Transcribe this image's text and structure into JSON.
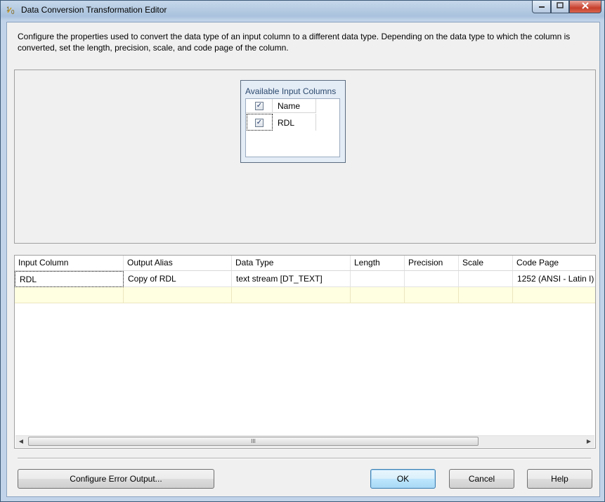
{
  "window": {
    "title": "Data Conversion Transformation Editor",
    "icon": "data-conversion-icon",
    "controls": {
      "minimize": "minimize-icon",
      "maximize": "maximize-icon",
      "close": "close-icon"
    }
  },
  "instructions": "Configure the properties used to convert the data type of an input column to a different data type. Depending on the data type to which the column is converted, set the length, precision, scale, and code page of the column.",
  "available_columns": {
    "title": "Available Input Columns",
    "header": "Name",
    "rows": [
      {
        "name": "RDL",
        "checked": true
      }
    ]
  },
  "grid": {
    "columns": [
      "Input Column",
      "Output Alias",
      "Data Type",
      "Length",
      "Precision",
      "Scale",
      "Code Page"
    ],
    "rows": [
      {
        "input_column": "RDL",
        "output_alias": "Copy of RDL",
        "data_type": "text stream [DT_TEXT]",
        "length": "",
        "precision": "",
        "scale": "",
        "code_page": "1252  (ANSI - Latin I)"
      }
    ],
    "scroll_indicator": "III"
  },
  "buttons": {
    "configure_error_output": "Configure Error Output...",
    "ok": "OK",
    "cancel": "Cancel",
    "help": "Help"
  },
  "colors": {
    "new_row": "#ffffe1",
    "title_text": "#2c4a6e"
  }
}
